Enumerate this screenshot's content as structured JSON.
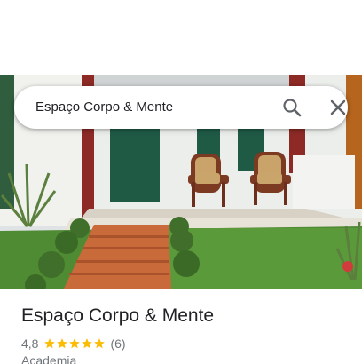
{
  "search": {
    "query": "Espaço Corpo & Mente"
  },
  "place": {
    "name": "Espaço Corpo & Mente",
    "rating": "4,8",
    "stars": 5,
    "reviews": "(6)",
    "category": "Academia"
  },
  "colors": {
    "star": "#fbbc04",
    "text_primary": "#202124",
    "text_secondary": "#70757a",
    "icon": "#5f6368"
  },
  "icons": {
    "search": "search-icon",
    "close": "close-icon",
    "star": "star-icon"
  }
}
